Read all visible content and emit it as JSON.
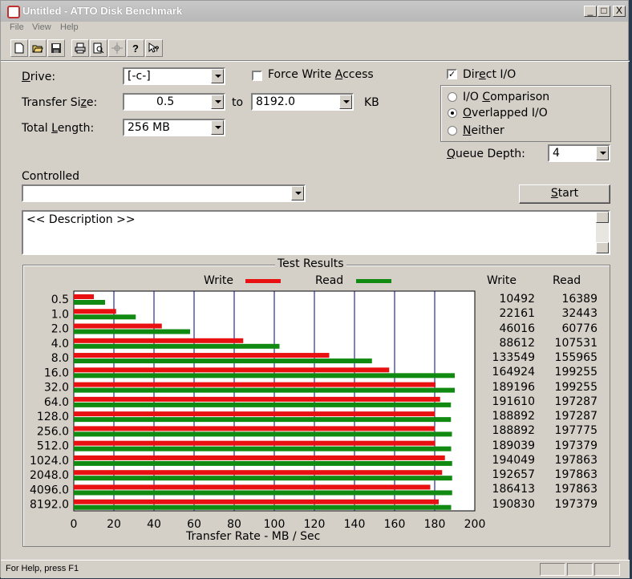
{
  "window": {
    "title": "Untitled - ATTO Disk Benchmark"
  },
  "titlebar_buttons": {
    "min": "_",
    "max": "□",
    "close": "X"
  },
  "menu": [
    "File",
    "View",
    "Help"
  ],
  "toolbar_icons": [
    "new-file-icon",
    "open-folder-icon",
    "save-icon",
    "print-icon",
    "print-preview-icon",
    "move-icon",
    "help-icon",
    "context-help-icon"
  ],
  "form": {
    "drive_label": "Drive:",
    "drive_value": "[-c-]",
    "force_write_label": "Force Write Access",
    "force_write_checked": false,
    "direct_io_label": "Direct I/O",
    "direct_io_checked": true,
    "transfer_size_label": "Transfer Size:",
    "transfer_from": "0.5",
    "to_label": "to",
    "transfer_to": "8192.0",
    "kb_label": "KB",
    "total_length_label": "Total Length:",
    "total_length_value": "256 MB",
    "io_options": [
      "I/O Comparison",
      "Overlapped I/O",
      "Neither"
    ],
    "io_selected": 1,
    "queue_depth_label": "Queue Depth:",
    "queue_depth_value": "4",
    "controlled_label": "Controlled",
    "controlled_value": "",
    "start_label": "Start",
    "description": "<< Description >>"
  },
  "results": {
    "title": "Test Results",
    "legend_write": "Write",
    "legend_read": "Read",
    "col_write": "Write",
    "col_read": "Read",
    "xlabel": "Transfer Rate - MB / Sec"
  },
  "chart_data": {
    "type": "bar",
    "orientation": "horizontal",
    "title": "Test Results",
    "xlabel": "Transfer Rate - MB / Sec",
    "xlim": [
      0,
      200
    ],
    "xticks": [
      0,
      20,
      40,
      60,
      80,
      100,
      120,
      140,
      160,
      180,
      200
    ],
    "categories": [
      "0.5",
      "1.0",
      "2.0",
      "4.0",
      "8.0",
      "16.0",
      "32.0",
      "64.0",
      "128.0",
      "256.0",
      "512.0",
      "1024.0",
      "2048.0",
      "4096.0",
      "8192.0"
    ],
    "series": [
      {
        "name": "Write",
        "color": "#e81010",
        "values": [
          10.0,
          21.1,
          43.9,
          84.5,
          127.4,
          157.3,
          180.4,
          182.7,
          180.1,
          180.1,
          180.3,
          185.1,
          183.7,
          177.8,
          182.0
        ]
      },
      {
        "name": "Read",
        "color": "#108a10",
        "values": [
          15.6,
          30.9,
          58.0,
          102.6,
          148.7,
          190.0,
          190.0,
          188.1,
          188.1,
          188.6,
          188.2,
          188.7,
          188.7,
          188.7,
          188.2
        ]
      }
    ],
    "write_values_text": [
      "10492",
      "22161",
      "46016",
      "88612",
      "133549",
      "164924",
      "189196",
      "191610",
      "188892",
      "188892",
      "189039",
      "194049",
      "192657",
      "186413",
      "190830"
    ],
    "read_values_text": [
      "16389",
      "32443",
      "60776",
      "107531",
      "155965",
      "199255",
      "199255",
      "197287",
      "197287",
      "197775",
      "197379",
      "197863",
      "197863",
      "197863",
      "197379"
    ],
    "grid": true
  },
  "status": {
    "help_text": "For Help, press F1"
  }
}
